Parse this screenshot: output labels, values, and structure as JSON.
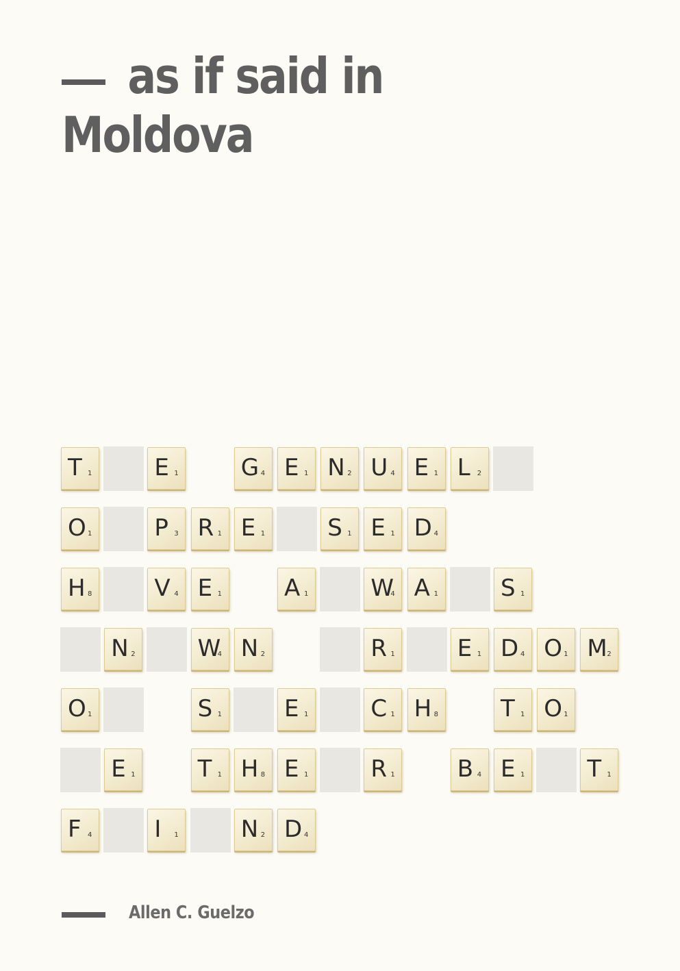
{
  "header": {
    "title_line1": "as if said in",
    "title_line2": "Moldova"
  },
  "board": {
    "rows": [
      [
        {
          "c": 0,
          "t": "T",
          "p": "1"
        },
        {
          "c": 1,
          "b": true
        },
        {
          "c": 2,
          "t": "E",
          "p": "1"
        },
        {
          "c": 4,
          "t": "G",
          "p": "4"
        },
        {
          "c": 5,
          "t": "E",
          "p": "1"
        },
        {
          "c": 6,
          "t": "N",
          "p": "2"
        },
        {
          "c": 7,
          "t": "U",
          "p": "4"
        },
        {
          "c": 8,
          "t": "E",
          "p": "1"
        },
        {
          "c": 9,
          "t": "L",
          "p": "2"
        },
        {
          "c": 10,
          "b": true
        }
      ],
      [
        {
          "c": 0,
          "t": "O",
          "p": "1"
        },
        {
          "c": 1,
          "b": true
        },
        {
          "c": 2,
          "t": "P",
          "p": "3"
        },
        {
          "c": 3,
          "t": "R",
          "p": "1"
        },
        {
          "c": 4,
          "t": "E",
          "p": "1"
        },
        {
          "c": 5,
          "b": true
        },
        {
          "c": 6,
          "t": "S",
          "p": "1"
        },
        {
          "c": 7,
          "t": "E",
          "p": "1"
        },
        {
          "c": 8,
          "t": "D",
          "p": "4"
        }
      ],
      [
        {
          "c": 0,
          "t": "H",
          "p": "8"
        },
        {
          "c": 1,
          "b": true
        },
        {
          "c": 2,
          "t": "V",
          "p": "4"
        },
        {
          "c": 3,
          "t": "E",
          "p": "1"
        },
        {
          "c": 5,
          "t": "A",
          "p": "1"
        },
        {
          "c": 6,
          "b": true
        },
        {
          "c": 7,
          "t": "W",
          "p": "4"
        },
        {
          "c": 8,
          "t": "A",
          "p": "1"
        },
        {
          "c": 9,
          "b": true
        },
        {
          "c": 10,
          "t": "S",
          "p": "1"
        }
      ],
      [
        {
          "c": 0,
          "b": true
        },
        {
          "c": 1,
          "t": "N",
          "p": "2"
        },
        {
          "c": 2,
          "b": true
        },
        {
          "c": 3,
          "t": "W",
          "p": "4"
        },
        {
          "c": 4,
          "t": "N",
          "p": "2"
        },
        {
          "c": 6,
          "b": true
        },
        {
          "c": 7,
          "t": "R",
          "p": "1"
        },
        {
          "c": 8,
          "b": true
        },
        {
          "c": 9,
          "t": "E",
          "p": "1"
        },
        {
          "c": 10,
          "t": "D",
          "p": "4"
        },
        {
          "c": 11,
          "t": "O",
          "p": "1"
        },
        {
          "c": 12,
          "t": "M",
          "p": "2"
        }
      ],
      [
        {
          "c": 0,
          "t": "O",
          "p": "1"
        },
        {
          "c": 1,
          "b": true
        },
        {
          "c": 3,
          "t": "S",
          "p": "1"
        },
        {
          "c": 4,
          "b": true
        },
        {
          "c": 5,
          "t": "E",
          "p": "1"
        },
        {
          "c": 6,
          "b": true
        },
        {
          "c": 7,
          "t": "C",
          "p": "1"
        },
        {
          "c": 8,
          "t": "H",
          "p": "8"
        },
        {
          "c": 10,
          "t": "T",
          "p": "1"
        },
        {
          "c": 11,
          "t": "O",
          "p": "1"
        }
      ],
      [
        {
          "c": 0,
          "b": true
        },
        {
          "c": 1,
          "t": "E",
          "p": "1"
        },
        {
          "c": 3,
          "t": "T",
          "p": "1"
        },
        {
          "c": 4,
          "t": "H",
          "p": "8"
        },
        {
          "c": 5,
          "t": "E",
          "p": "1"
        },
        {
          "c": 6,
          "b": true
        },
        {
          "c": 7,
          "t": "R",
          "p": "1"
        },
        {
          "c": 9,
          "t": "B",
          "p": "4"
        },
        {
          "c": 10,
          "t": "E",
          "p": "1"
        },
        {
          "c": 11,
          "b": true
        },
        {
          "c": 12,
          "t": "T",
          "p": "1"
        }
      ],
      [
        {
          "c": 0,
          "t": "F",
          "p": "4"
        },
        {
          "c": 1,
          "b": true
        },
        {
          "c": 2,
          "t": "I",
          "p": "1"
        },
        {
          "c": 3,
          "b": true
        },
        {
          "c": 4,
          "t": "N",
          "p": "2"
        },
        {
          "c": 5,
          "t": "D",
          "p": "4"
        }
      ]
    ]
  },
  "footer": {
    "author": "Allen C. Guelzo"
  }
}
